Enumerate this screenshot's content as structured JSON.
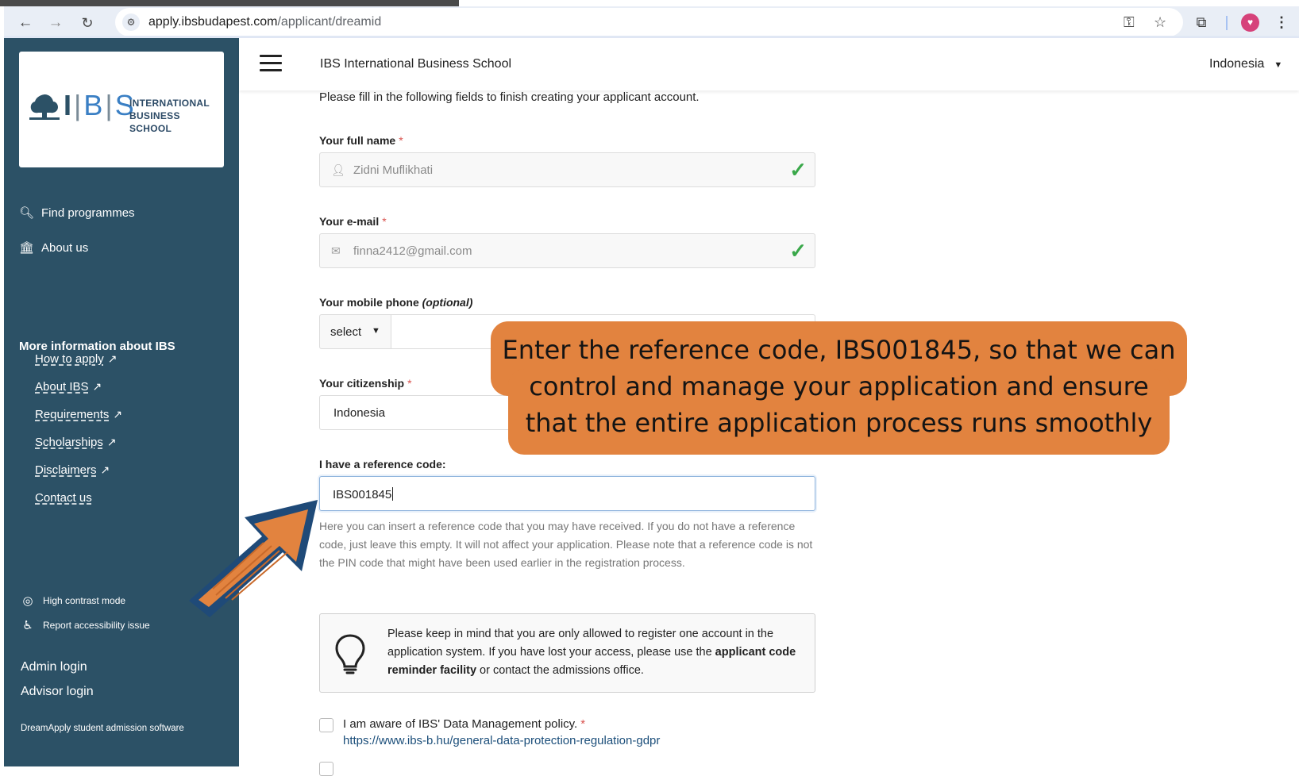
{
  "browser": {
    "url_host": "apply.ibsbudapest.com",
    "url_path": "/applicant/dreamid"
  },
  "sidebar": {
    "logo": {
      "mark": "IBS",
      "line1": "INTERNATIONAL",
      "line2": "BUSINESS SCHOOL"
    },
    "nav": [
      {
        "label": "Find programmes",
        "icon": "search-icon"
      },
      {
        "label": "About us",
        "icon": "institution-icon"
      }
    ],
    "more_heading": "More information about IBS",
    "links": [
      {
        "label": "How to apply"
      },
      {
        "label": "About IBS"
      },
      {
        "label": "Requirements"
      },
      {
        "label": "Scholarships"
      },
      {
        "label": "Disclaimers"
      },
      {
        "label": "Contact us"
      }
    ],
    "accessibility": [
      {
        "label": "High contrast mode",
        "icon": "contrast-icon"
      },
      {
        "label": "Report accessibility issue",
        "icon": "accessibility-icon"
      }
    ],
    "admin_login": "Admin login",
    "advisor_login": "Advisor login",
    "footer": "DreamApply student admission software"
  },
  "header": {
    "school_name": "IBS International Business School",
    "country": "Indonesia"
  },
  "form": {
    "intro": "Please fill in the following fields to finish creating your applicant account.",
    "full_name": {
      "label": "Your full name",
      "required": "*",
      "value": "Zidni Muflikhati"
    },
    "email": {
      "label": "Your e-mail",
      "required": "*",
      "value": "finna2412@gmail.com"
    },
    "phone": {
      "label": "Your mobile phone",
      "optional": "(optional)",
      "select_value": "select",
      "value": ""
    },
    "citizenship": {
      "label": "Your citizenship",
      "required": "*",
      "value": "Indonesia"
    },
    "reference": {
      "label": "I have a reference code:",
      "value": "IBS001845",
      "help": "Here you can insert a reference code that you may have received. If you do not have a reference code, just leave this empty. It will not affect your application. Please note that a reference code is not the PIN code that might have been used earlier in the registration process."
    },
    "notice": {
      "text_before": "Please keep in mind that you are only allowed to register one account in the application system. If you have lost your access, please use the ",
      "bold": "applicant code reminder facility",
      "text_after": " or contact the admissions office."
    },
    "policy": {
      "label": "I am aware of IBS' Data Management policy.",
      "required": "*",
      "link": "https://www.ibs-b.hu/general-data-protection-regulation-gdpr"
    }
  },
  "callout": {
    "line1": "Enter the reference code, IBS001845, so that we can",
    "line2": "control and manage your application and ensure",
    "line3": "that the entire application process runs smoothly"
  },
  "colors": {
    "sidebar": "#2c5166",
    "callout": "#e2833f",
    "valid_check": "#3aa84a",
    "required": "#d9534f",
    "link": "#1b4e7a"
  }
}
